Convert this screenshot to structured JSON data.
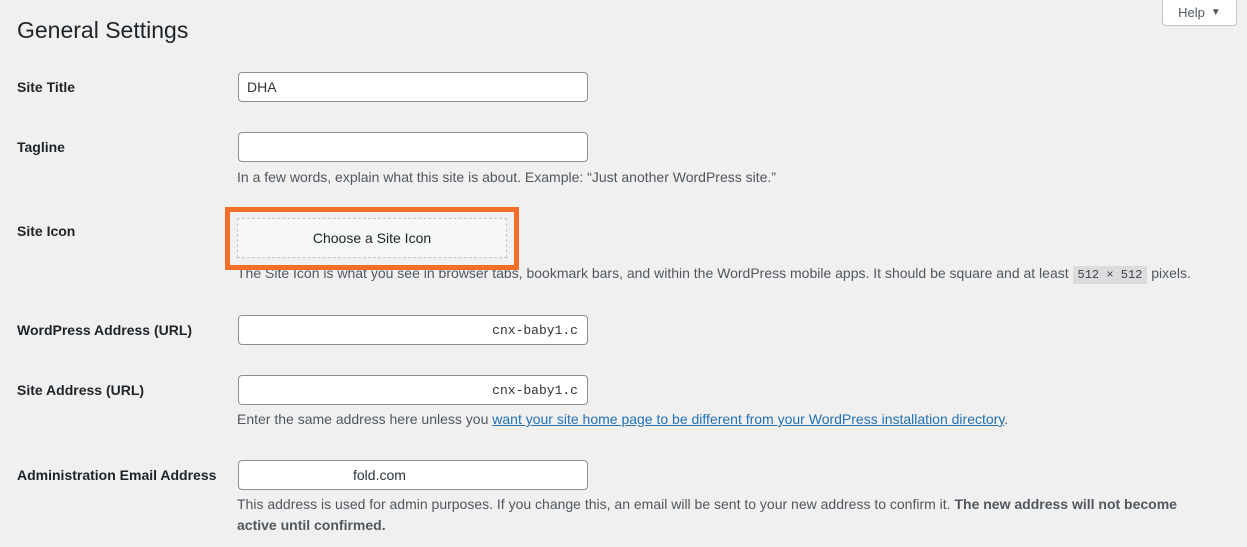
{
  "header": {
    "title": "General Settings",
    "help_label": "Help",
    "help_caret": "▼"
  },
  "fields": {
    "site_title": {
      "label": "Site Title",
      "value": "DHA"
    },
    "tagline": {
      "label": "Tagline",
      "value": "",
      "description": "In a few words, explain what this site is about. Example: “Just another WordPress site.”"
    },
    "site_icon": {
      "label": "Site Icon",
      "button_label": "Choose a Site Icon",
      "description_before": "The Site Icon is what you see in browser tabs, bookmark bars, and within the WordPress mobile apps. It should be square and at least",
      "description_code": "512 × 512",
      "description_after": "pixels."
    },
    "wp_address": {
      "label": "WordPress Address (URL)",
      "value": "cnx-baby1.c"
    },
    "site_address": {
      "label": "Site Address (URL)",
      "value": "cnx-baby1.c",
      "description_before": "Enter the same address here unless you",
      "description_link": "want your site home page to be different from your WordPress installation directory",
      "description_after": "."
    },
    "admin_email": {
      "label": "Administration Email Address",
      "value": "fold.com",
      "description_before": "This address is used for admin purposes. If you change this, an email will be sent to your new address to confirm it.",
      "description_strong": "The new address will not become active until confirmed."
    }
  },
  "colors": {
    "highlight": "#f56e28",
    "link": "#2271b1",
    "background": "#f0f0f1"
  }
}
